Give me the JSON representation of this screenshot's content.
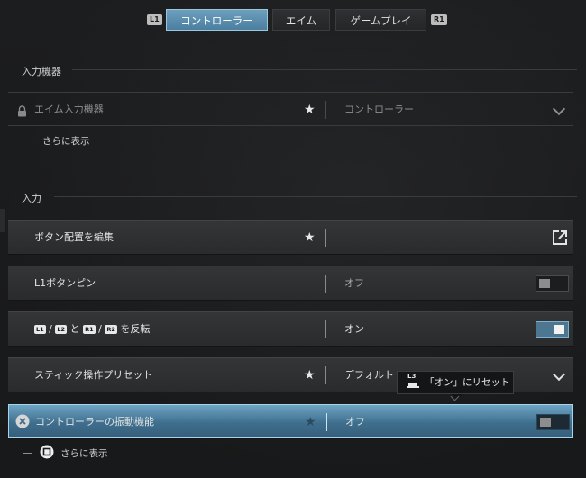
{
  "tabs": {
    "left_hint": "L1",
    "right_hint": "R1",
    "items": [
      "コントローラー",
      "エイム",
      "ゲームプレイ"
    ],
    "active": 0
  },
  "sections": {
    "input_device": "入力機器",
    "input": "入力"
  },
  "rows": {
    "aim_device": {
      "label": "エイム入力機器",
      "value": "コントローラー",
      "locked": true
    },
    "show_more_1": "さらに表示",
    "edit_buttons": {
      "label": "ボタン配置を編集"
    },
    "l1_pin": {
      "label": "L1ボタンピン",
      "value": "オフ",
      "toggle": false
    },
    "swap": {
      "btn_l1": "L1",
      "sep1": "/",
      "btn_l2": "L2",
      "and": "と",
      "btn_r1": "R1",
      "sep2": "/",
      "btn_r2": "R2",
      "suffix": "を反転",
      "value": "オン",
      "toggle": true
    },
    "stick_preset": {
      "label": "スティック操作プリセット",
      "value": "デフォルト"
    },
    "vibration": {
      "label": "コントローラーの振動機能",
      "value": "オフ",
      "toggle": false
    },
    "show_more_2": "さらに表示"
  },
  "tooltip": {
    "button": "L3",
    "text": "「オン」にリセット"
  },
  "colors": {
    "accent": "#4b7fa0",
    "selected_row": "#3f6f8e",
    "background": "#1a1b1c"
  }
}
